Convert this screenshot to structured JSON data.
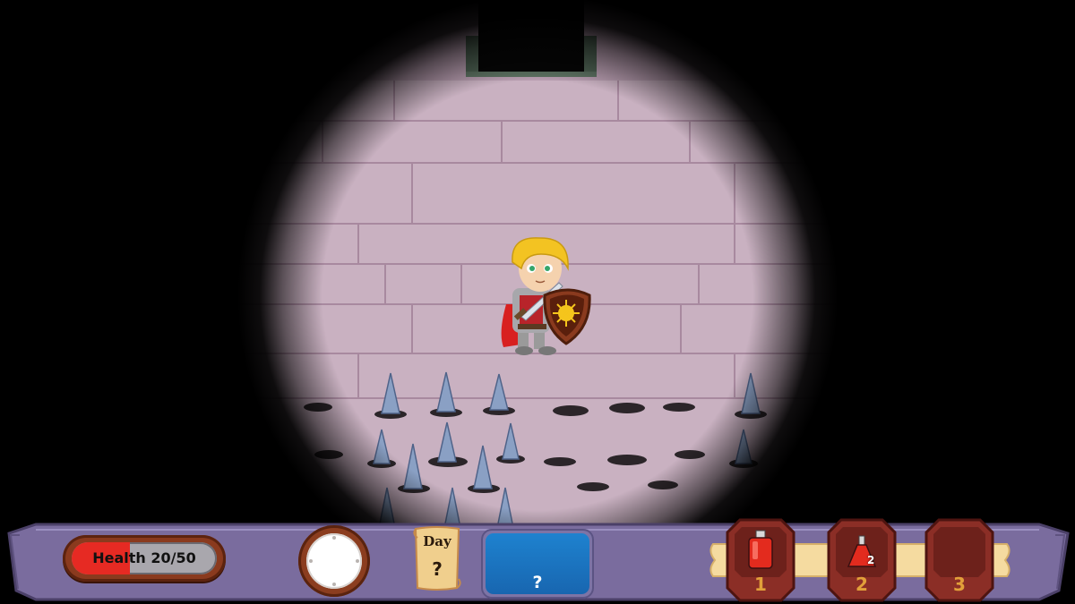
{
  "player": {
    "health_label": "Health 20/50",
    "health_current": 20,
    "health_max": 50
  },
  "day": {
    "label": "Day",
    "value": "?"
  },
  "event": {
    "text": "?"
  },
  "inventory": [
    {
      "slot": "1",
      "item": "red-potion-bottle-icon",
      "count": null
    },
    {
      "slot": "2",
      "item": "red-flask-icon",
      "count": "2"
    },
    {
      "slot": "3",
      "item": "empty-slot",
      "count": null
    }
  ],
  "colors": {
    "health_fill": "#e62a23",
    "hud_bar": "#7a6c9e",
    "event_panel": "#1e82cf",
    "slot_frame": "#8b2e26",
    "slot_number": "#e2a03a"
  }
}
